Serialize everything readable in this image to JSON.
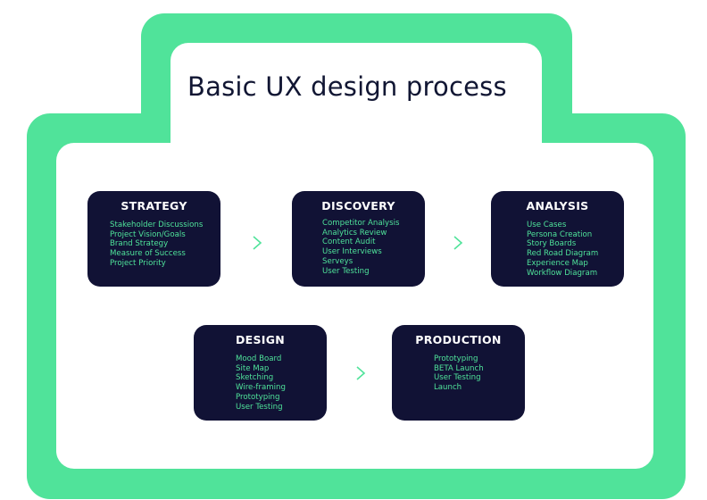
{
  "title": "Basic UX design process",
  "colors": {
    "frame": "#50e39a",
    "panel": "#ffffff",
    "card": "#111235",
    "card_title": "#ffffff",
    "card_text": "#4fe39a",
    "title_text": "#111633"
  },
  "stages": [
    {
      "title": "STRATEGY",
      "items": [
        "Stakeholder Discussions",
        "Project Vision/Goals",
        "Brand Strategy",
        "Measure of Success",
        "Project Priority"
      ]
    },
    {
      "title": "DISCOVERY",
      "items": [
        "Competitor Analysis",
        "Analytics Review",
        "Content Audit",
        "User Interviews",
        "Serveys",
        "User Testing"
      ]
    },
    {
      "title": "ANALYSIS",
      "items": [
        "Use Cases",
        "Persona Creation",
        "Story Boards",
        "Red Road Diagram",
        "Experience Map",
        "Workflow Diagram"
      ]
    },
    {
      "title": "DESIGN",
      "items": [
        "Mood Board",
        "Site Map",
        "Sketching",
        "Wire-framing",
        "Prototyping",
        "User Testing"
      ]
    },
    {
      "title": "PRODUCTION",
      "items": [
        "Prototyping",
        "BETA Launch",
        "User Testing",
        "Launch"
      ]
    }
  ],
  "connector_icon": "chevron-right-icon"
}
